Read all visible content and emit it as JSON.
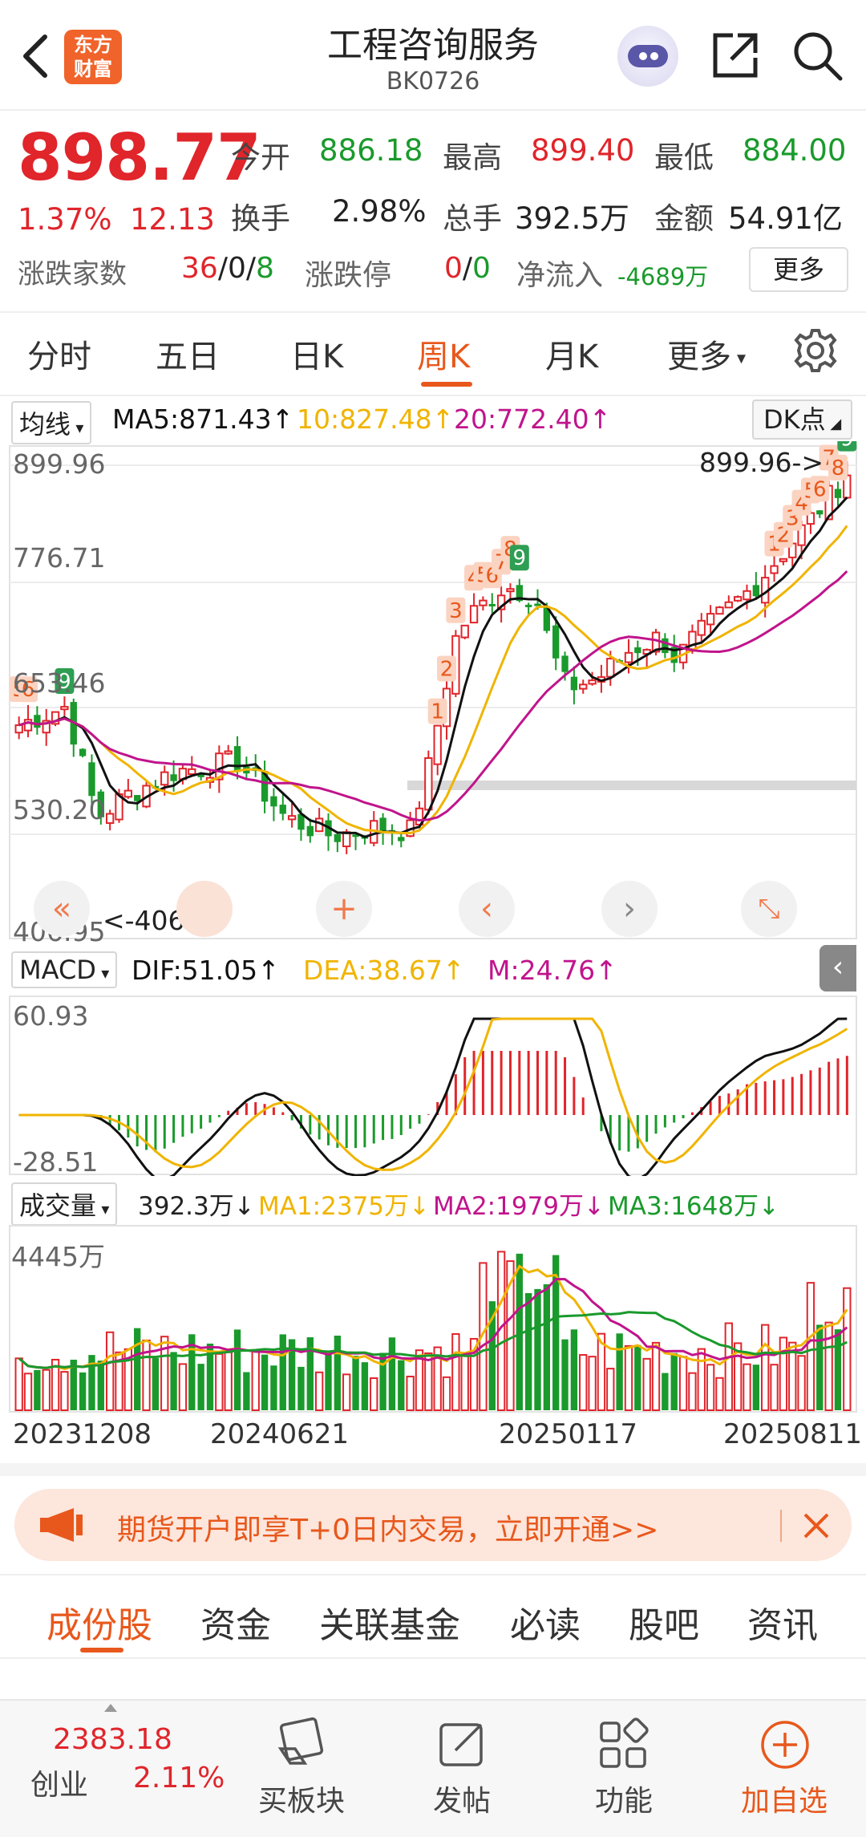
{
  "header": {
    "title": "工程咨询服务",
    "code": "BK0726",
    "logo_line1": "东方",
    "logo_line2": "财富"
  },
  "quote": {
    "price": "898.77",
    "change_pct": "1.37%",
    "change": "12.13",
    "open_label": "今开",
    "open": "886.18",
    "high_label": "最高",
    "high": "899.40",
    "low_label": "最低",
    "low": "884.00",
    "turnover_label": "换手",
    "turnover": "2.98%",
    "volume_label": "总手",
    "volume": "392.5万",
    "amount_label": "金额",
    "amount": "54.91亿",
    "breadth_label": "涨跌家数",
    "breadth_up": "36",
    "breadth_flat": "0",
    "breadth_down": "8",
    "limit_label": "涨跌停",
    "limit_up": "0",
    "limit_down": "0",
    "netflow_label": "净流入",
    "netflow": "-4689万",
    "more": "更多",
    "sep": "/"
  },
  "period_tabs": [
    "分时",
    "五日",
    "日K",
    "周K",
    "月K",
    "更多"
  ],
  "active_period": "周K",
  "colors": {
    "up": "#e0252b",
    "down": "#1a9a2c",
    "accent": "#e8581c",
    "ma5": "#111111",
    "ma10": "#f0b400",
    "ma20": "#c0148c"
  },
  "kline": {
    "selector": "均线",
    "ma5": "MA5:871.43↑",
    "ma10": "10:827.48↑",
    "ma20": "20:772.40↑",
    "dk": "DK点",
    "y_ticks": [
      "899.96",
      "776.71",
      "653.46",
      "530.20",
      "406.95"
    ],
    "max_label": "899.96->",
    "min_label": "<-406.95"
  },
  "macd": {
    "selector": "MACD",
    "dif": "DIF:51.05↑",
    "dea": "DEA:38.67↑",
    "m": "M:24.76↑",
    "y_top": "60.93",
    "y_bottom": "-28.51"
  },
  "volume": {
    "selector": "成交量",
    "vol": "392.3万↓",
    "ma1": "MA1:2375万↓",
    "ma2": "MA2:1979万↓",
    "ma3": "MA3:1648万↓",
    "y_top": "4445万",
    "x_ticks": [
      "20231208",
      "20240621",
      "20250117",
      "20250811"
    ]
  },
  "promo": {
    "text": "期货开户即享T+0日内交易，立即开通>>"
  },
  "content_tabs": [
    "成份股",
    "资金",
    "关联基金",
    "必读",
    "股吧",
    "资讯"
  ],
  "active_content_tab": "成份股",
  "bottom_bar": {
    "index_value": "2383.18",
    "index_name": "创业",
    "index_pct": "2.11%",
    "buy_label": "买板块",
    "post_label": "发帖",
    "func_label": "功能",
    "add_label": "加自选"
  }
}
